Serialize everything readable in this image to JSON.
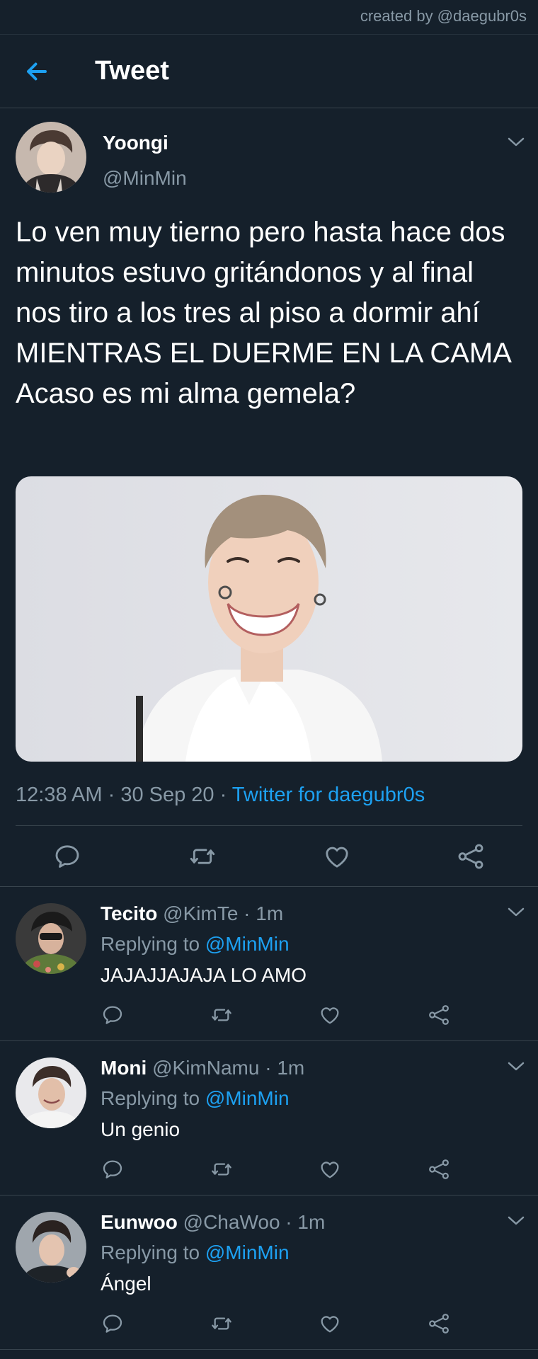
{
  "credit": "created by @daegubr0s",
  "header": {
    "title": "Tweet",
    "back_icon": "arrow-left-icon"
  },
  "accent": "#1da1f2",
  "background": "#15202b",
  "tweet": {
    "name": "Yoongi",
    "handle": "@MinMin",
    "text": "Lo ven muy tierno pero hasta hace dos minutos estuvo gritándonos y al final nos tiro a los tres al piso a dormir ahí MIENTRAS EL DUERME EN LA CAMA Acaso es mi alma gemela?",
    "time": "12:38 AM",
    "date": "30 Sep 20",
    "source": "Twitter for daegubr0s",
    "actions": [
      "reply-icon",
      "retweet-icon",
      "like-icon",
      "share-icon"
    ]
  },
  "replies": [
    {
      "name": "Tecito",
      "handle": "@KimTe",
      "time": "1m",
      "replying_label": "Replying to",
      "replying_to": "@MinMin",
      "text": "JAJAJJAJAJA LO AMO"
    },
    {
      "name": "Moni",
      "handle": "@KimNamu",
      "time": "1m",
      "replying_label": "Replying to",
      "replying_to": "@MinMin",
      "text": "Un genio"
    },
    {
      "name": "Eunwoo",
      "handle": "@ChaWoo",
      "time": "1m",
      "replying_label": "Replying to",
      "replying_to": "@MinMin",
      "text": "Ángel"
    }
  ]
}
